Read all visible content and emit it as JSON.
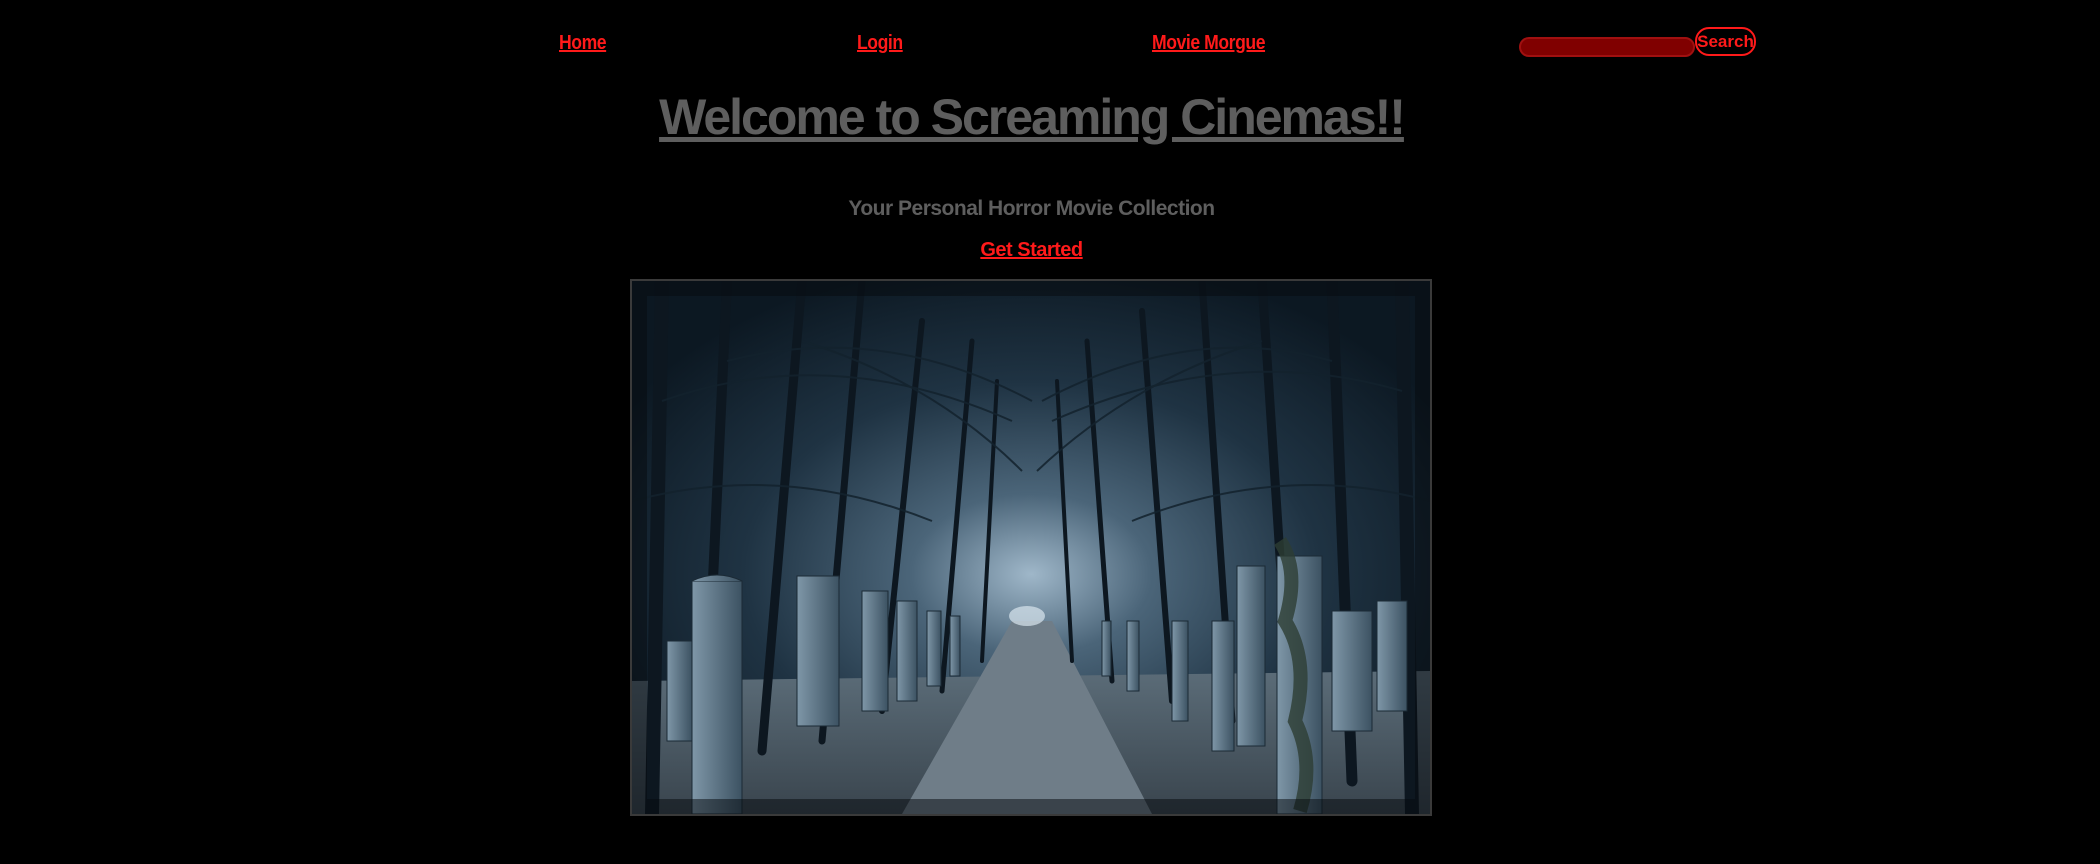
{
  "nav": {
    "home_label": "Home",
    "login_label": "Login",
    "movie_morgue_label": "Movie Morgue"
  },
  "search": {
    "placeholder": "",
    "value": "",
    "button_label": "Search"
  },
  "hero": {
    "title": "Welcome to Screaming Cinemas!!",
    "subtitle": "Your Personal Horror Movie Collection",
    "cta_label": "Get Started",
    "image_icon": "cemetery-path-photo"
  },
  "colors": {
    "background": "#000000",
    "link": "#ff1a1a",
    "heading": "#5e5e5e",
    "search_field": "#800000"
  }
}
